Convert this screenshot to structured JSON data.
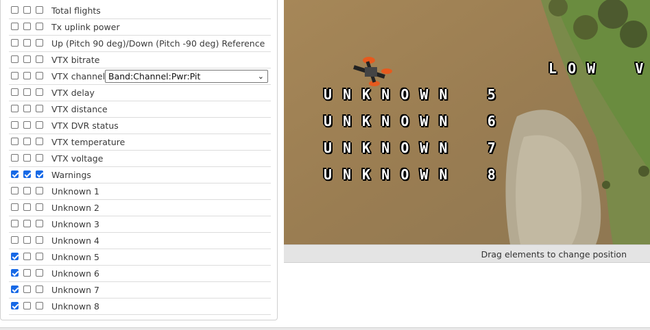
{
  "osd_items": [
    {
      "label": "Total flights",
      "checks": [
        false,
        false,
        false
      ]
    },
    {
      "label": "Tx uplink power",
      "checks": [
        false,
        false,
        false
      ]
    },
    {
      "label": "Up (Pitch 90 deg)/Down (Pitch -90 deg) Reference",
      "checks": [
        false,
        false,
        false
      ]
    },
    {
      "label": "VTX bitrate",
      "checks": [
        false,
        false,
        false
      ]
    },
    {
      "label": "VTX channel",
      "checks": [
        false,
        false,
        false
      ],
      "select": "Band:Channel:Pwr:Pit"
    },
    {
      "label": "VTX delay",
      "checks": [
        false,
        false,
        false
      ]
    },
    {
      "label": "VTX distance",
      "checks": [
        false,
        false,
        false
      ]
    },
    {
      "label": "VTX DVR status",
      "checks": [
        false,
        false,
        false
      ]
    },
    {
      "label": "VTX temperature",
      "checks": [
        false,
        false,
        false
      ]
    },
    {
      "label": "VTX voltage",
      "checks": [
        false,
        false,
        false
      ]
    },
    {
      "label": "Warnings",
      "checks": [
        true,
        true,
        true
      ]
    },
    {
      "label": "Unknown 1",
      "checks": [
        false,
        false,
        false
      ]
    },
    {
      "label": "Unknown 2",
      "checks": [
        false,
        false,
        false
      ]
    },
    {
      "label": "Unknown 3",
      "checks": [
        false,
        false,
        false
      ]
    },
    {
      "label": "Unknown 4",
      "checks": [
        false,
        false,
        false
      ]
    },
    {
      "label": "Unknown 5",
      "checks": [
        true,
        false,
        false
      ]
    },
    {
      "label": "Unknown 6",
      "checks": [
        true,
        false,
        false
      ]
    },
    {
      "label": "Unknown 7",
      "checks": [
        true,
        false,
        false
      ]
    },
    {
      "label": "Unknown 8",
      "checks": [
        true,
        false,
        false
      ]
    }
  ],
  "preview": {
    "osd_elements": [
      "UNKNOWN 5",
      "UNKNOWN 6",
      "UNKNOWN 7",
      "UNKNOWN 8"
    ],
    "warning_text": "LOW VO",
    "footer_hint": "Drag elements to change position"
  },
  "colors": {
    "checked": "#1769e6",
    "osd_text": "#ffffff"
  }
}
